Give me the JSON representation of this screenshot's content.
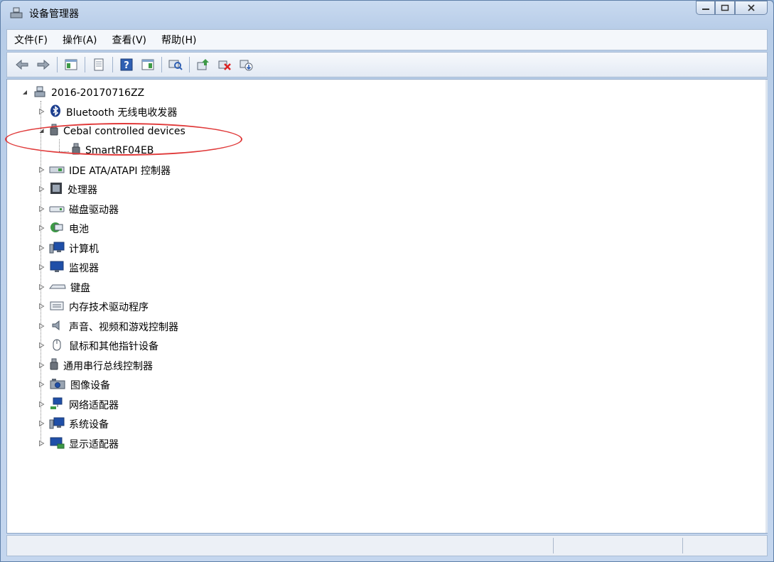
{
  "window": {
    "title": "设备管理器"
  },
  "menu": [
    {
      "label": "文件(F)"
    },
    {
      "label": "操作(A)"
    },
    {
      "label": "查看(V)"
    },
    {
      "label": "帮助(H)"
    }
  ],
  "tree": {
    "root": {
      "label": "2016-20170716ZZ"
    },
    "nodes": [
      {
        "label": "Bluetooth 无线电收发器",
        "icon": "bluetooth-icon"
      },
      {
        "label": "Cebal controlled devices",
        "icon": "usb-plug-icon"
      },
      {
        "label": "SmartRF04EB",
        "icon": "usb-plug-icon"
      },
      {
        "label": "IDE ATA/ATAPI 控制器",
        "icon": "ide-controller-icon"
      },
      {
        "label": "处理器",
        "icon": "cpu-icon"
      },
      {
        "label": "磁盘驱动器",
        "icon": "disk-drive-icon"
      },
      {
        "label": "电池",
        "icon": "battery-icon"
      },
      {
        "label": "计算机",
        "icon": "computer-icon"
      },
      {
        "label": "监视器",
        "icon": "monitor-icon"
      },
      {
        "label": "键盘",
        "icon": "keyboard-icon"
      },
      {
        "label": "内存技术驱动程序",
        "icon": "memory-icon"
      },
      {
        "label": "声音、视频和游戏控制器",
        "icon": "speaker-icon"
      },
      {
        "label": "鼠标和其他指针设备",
        "icon": "mouse-icon"
      },
      {
        "label": "通用串行总线控制器",
        "icon": "usb-plug-icon"
      },
      {
        "label": "图像设备",
        "icon": "camera-icon"
      },
      {
        "label": "网络适配器",
        "icon": "network-icon"
      },
      {
        "label": "系统设备",
        "icon": "system-icon"
      },
      {
        "label": "显示适配器",
        "icon": "display-adapter-icon"
      }
    ]
  },
  "colors": {
    "annotation": "#e03a3a"
  }
}
